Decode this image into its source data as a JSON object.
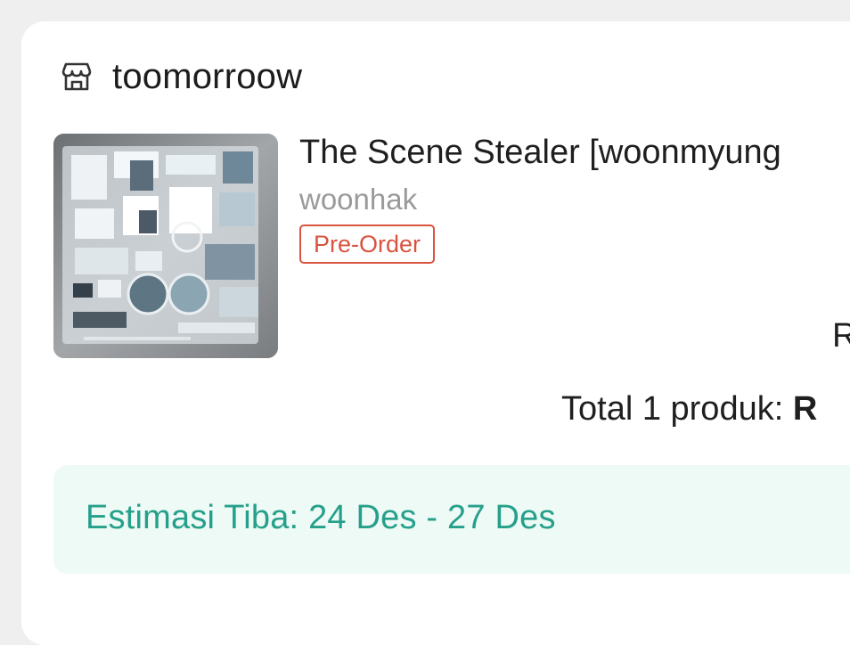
{
  "shop": {
    "name": "toomorroow",
    "icon": "store-icon"
  },
  "product": {
    "title": "The Scene Stealer [woonmyung",
    "variant": "woonhak",
    "badge": "Pre-Order",
    "price_partial": "R",
    "image_alt": "product-image"
  },
  "summary": {
    "total_label": "Total 1 produk:",
    "total_value_partial": "R"
  },
  "estimate": {
    "text": "Estimasi Tiba: 24 Des - 27 Des"
  },
  "colors": {
    "accent_green": "#26a08a",
    "estimate_bg": "#eefaf6",
    "preorder_red": "#d9533f"
  }
}
